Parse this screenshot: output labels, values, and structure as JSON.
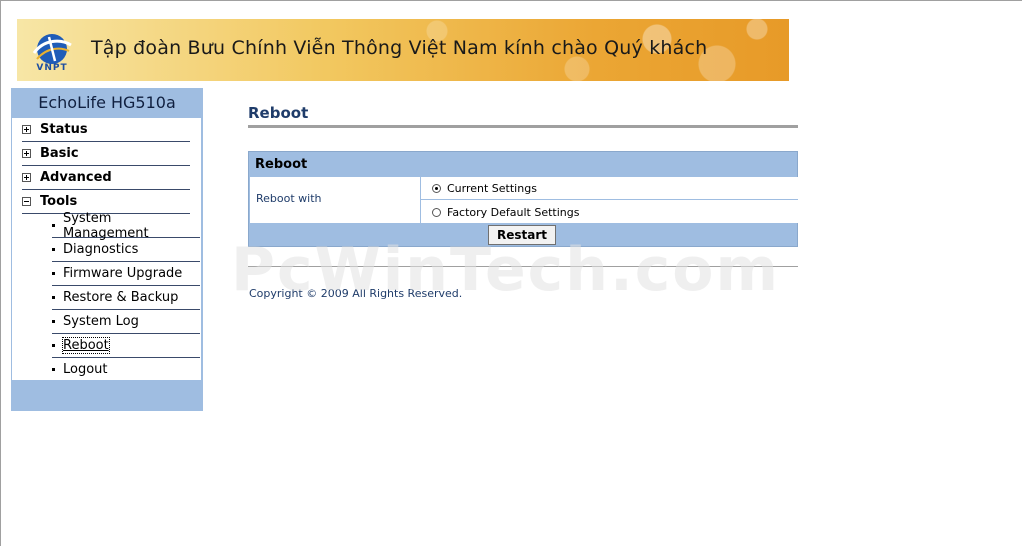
{
  "banner": {
    "logo_text": "VNPT",
    "greeting": "Tập đoàn Bưu Chính Viễn Thông Việt Nam kính chào Quý khách"
  },
  "sidebar": {
    "device_title": "EchoLife HG510a",
    "menu": [
      {
        "label": "Status",
        "expanded": false
      },
      {
        "label": "Basic",
        "expanded": false
      },
      {
        "label": "Advanced",
        "expanded": false
      },
      {
        "label": "Tools",
        "expanded": true
      }
    ],
    "tools_items": [
      {
        "label": "System Management"
      },
      {
        "label": "Diagnostics"
      },
      {
        "label": "Firmware Upgrade"
      },
      {
        "label": "Restore & Backup"
      },
      {
        "label": "System Log"
      },
      {
        "label": "Reboot",
        "active": true
      },
      {
        "label": "Logout"
      }
    ]
  },
  "main": {
    "page_title": "Reboot",
    "panel_title": "Reboot",
    "reboot_with_label": "Reboot with",
    "options": [
      {
        "label": "Current Settings",
        "selected": true
      },
      {
        "label": "Factory Default Settings",
        "selected": false
      }
    ],
    "restart_button": "Restart",
    "copyright": "Copyright © 2009 All Rights Reserved."
  },
  "watermark": "PcWinTech.com",
  "colors": {
    "sidebar_bg": "#9fbde1",
    "title_text": "#1f3c6a",
    "divider": "#a0a0a0"
  }
}
